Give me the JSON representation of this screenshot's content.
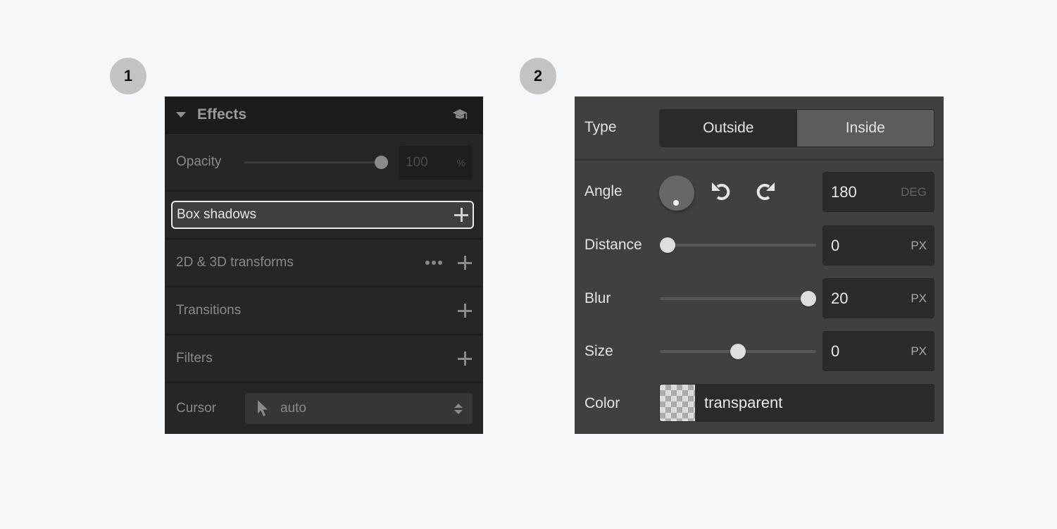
{
  "badges": [
    "1",
    "2"
  ],
  "effects_panel": {
    "title": "Effects",
    "opacity": {
      "label": "Opacity",
      "value": "100",
      "unit": "%",
      "slider_fraction": 1.0
    },
    "box_shadows": {
      "label": "Box shadows",
      "highlighted": true
    },
    "transforms": {
      "label": "2D & 3D transforms"
    },
    "transitions": {
      "label": "Transitions"
    },
    "filters": {
      "label": "Filters"
    },
    "cursor": {
      "label": "Cursor",
      "value": "auto"
    }
  },
  "shadow_panel": {
    "type": {
      "label": "Type",
      "options": [
        "Outside",
        "Inside"
      ],
      "selected": "Inside"
    },
    "angle": {
      "label": "Angle",
      "value": "180",
      "unit": "DEG"
    },
    "distance": {
      "label": "Distance",
      "value": "0",
      "unit": "PX",
      "slider_fraction": 0.0
    },
    "blur": {
      "label": "Blur",
      "value": "20",
      "unit": "PX",
      "slider_fraction": 1.0
    },
    "size": {
      "label": "Size",
      "value": "0",
      "unit": "PX",
      "slider_fraction": 0.5
    },
    "color": {
      "label": "Color",
      "value": "transparent"
    }
  }
}
